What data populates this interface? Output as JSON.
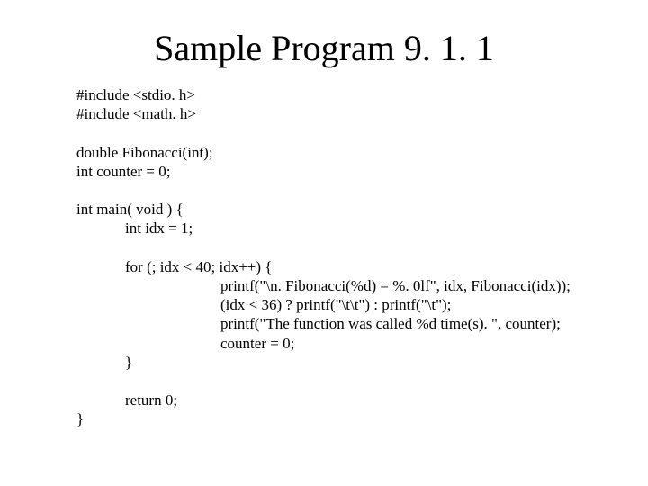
{
  "title": "Sample Program 9. 1. 1",
  "code": {
    "l1": "#include <stdio. h>",
    "l2": "#include <math. h>",
    "l3": "double Fibonacci(int);",
    "l4": "int counter = 0;",
    "l5": "int main( void ) {",
    "l6": "int idx = 1;",
    "l7": "for (; idx < 40; idx++) {",
    "l8": "printf(\"\\n. Fibonacci(%d) = %. 0lf\", idx, Fibonacci(idx));",
    "l9": "(idx < 36) ? printf(\"\\t\\t\") : printf(\"\\t\");",
    "l10": "printf(\"The function was called %d time(s). \", counter);",
    "l11": "counter = 0;",
    "l12": "}",
    "l13": "return 0;",
    "l14": "}"
  }
}
